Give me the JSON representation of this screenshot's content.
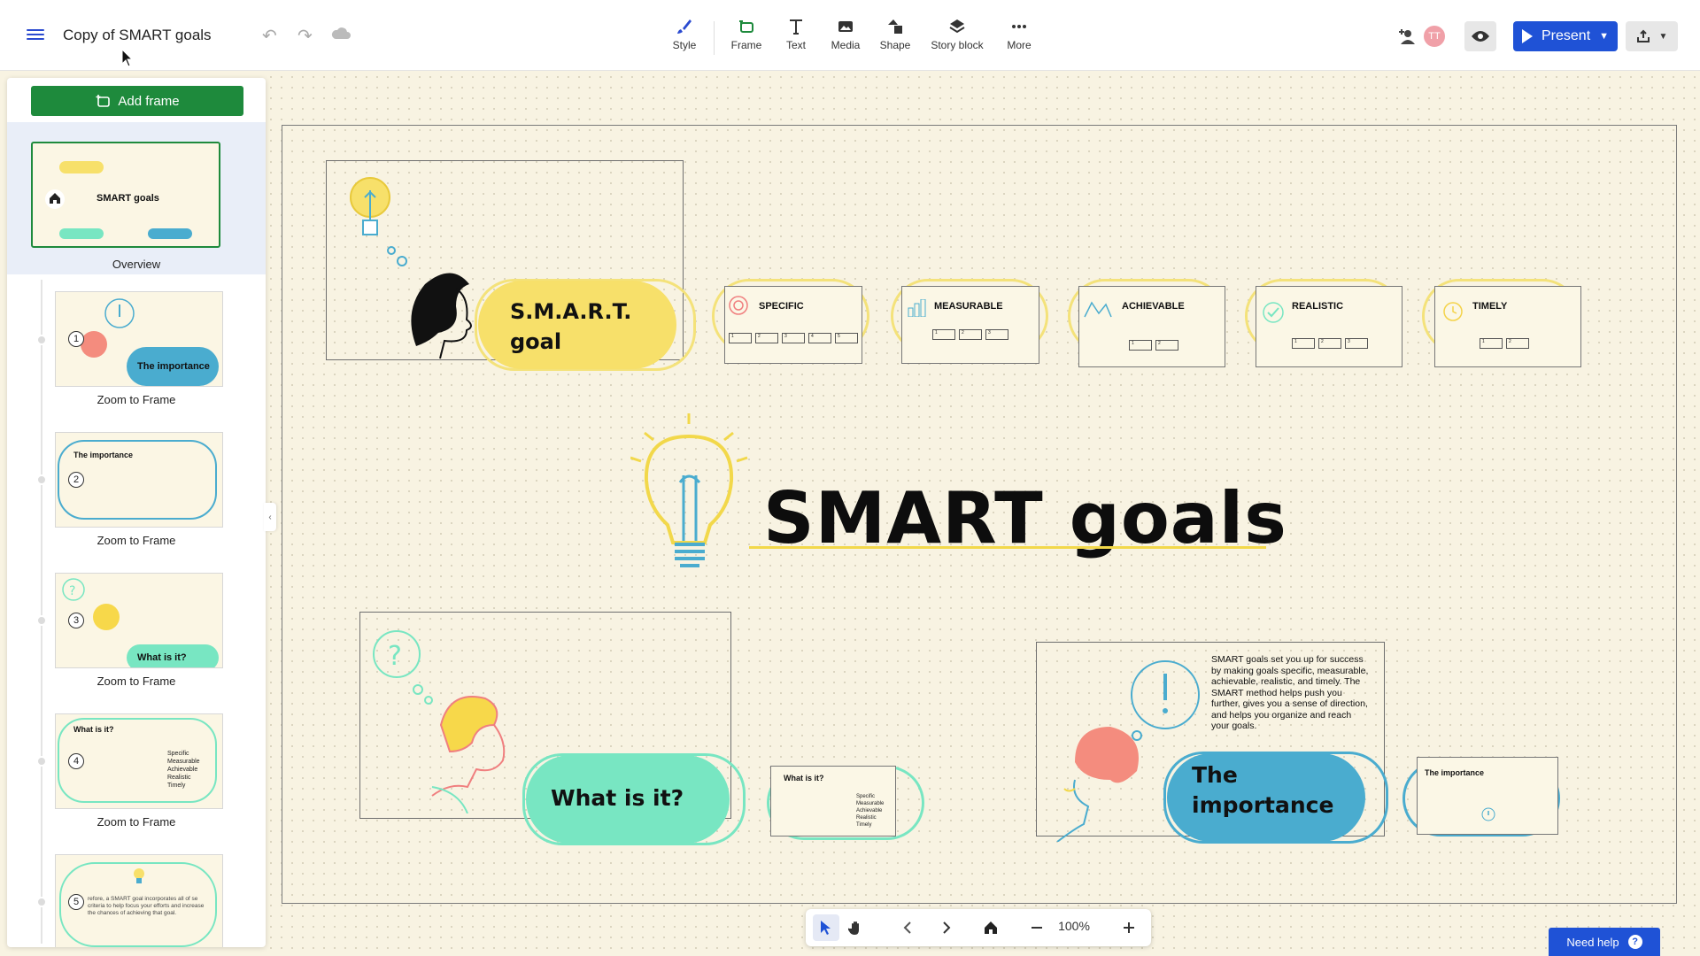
{
  "app": {
    "doc_title": "Copy of SMART goals"
  },
  "toolbar": {
    "tools": [
      {
        "label": "Style",
        "icon": "brush-icon"
      },
      {
        "label": "Frame",
        "icon": "frame-icon"
      },
      {
        "label": "Text",
        "icon": "text-icon"
      },
      {
        "label": "Media",
        "icon": "media-icon"
      },
      {
        "label": "Shape",
        "icon": "shape-icon"
      },
      {
        "label": "Story block",
        "icon": "layers-icon"
      },
      {
        "label": "More",
        "icon": "more-icon"
      }
    ],
    "avatar_initials": "TT",
    "present_label": "Present"
  },
  "sidebar": {
    "add_frame_label": "Add frame",
    "overview_label": "Overview",
    "overview_thumb_title": "SMART goals",
    "frames": [
      {
        "number": "1",
        "label": "Zoom to Frame",
        "title": "The importance"
      },
      {
        "number": "2",
        "label": "Zoom to Frame",
        "title": "The importance"
      },
      {
        "number": "3",
        "label": "Zoom to Frame",
        "title": "What is it?"
      },
      {
        "number": "4",
        "label": "Zoom to Frame",
        "title": "What is it?"
      },
      {
        "number": "5",
        "label": "Zoom to Frame",
        "title": ""
      }
    ],
    "frame4_lines": [
      "Specific",
      "Measurable",
      "Achievable",
      "Realistic",
      "Timely"
    ],
    "frame5_text": "refore, a SMART goal incorporates all of se criteria to help focus your efforts and increase the chances of achieving that goal."
  },
  "canvas": {
    "main_title": "SMART goals",
    "smart_goal_line1": "S.M.A.R.T.",
    "smart_goal_line2": "goal",
    "what_is_it": "What is it?",
    "importance_line1": "The",
    "importance_line2": "importance",
    "importance_body": "SMART goals set you up for success by making goals specific, measurable, achievable, realistic, and timely. The SMART method helps push you further, gives you a sense of direction, and helps you organize and reach your goals.",
    "cards": [
      {
        "title": "SPECIFIC"
      },
      {
        "title": "MEASURABLE"
      },
      {
        "title": "ACHIEVABLE"
      },
      {
        "title": "REALISTIC"
      },
      {
        "title": "TIMELY"
      }
    ],
    "what_card_title": "What is it?",
    "what_card_lines": [
      "Specific",
      "Measurable",
      "Achievable",
      "Realistic",
      "Timely"
    ],
    "imp_card_title": "The importance"
  },
  "bottom_bar": {
    "zoom": "100%"
  },
  "help": {
    "label": "Need help"
  },
  "colors": {
    "accent": "#1f52d6",
    "add_frame": "#1e8a3c",
    "yellow": "#f7e06a",
    "mint": "#78e6c2",
    "teal": "#4aaccf"
  }
}
